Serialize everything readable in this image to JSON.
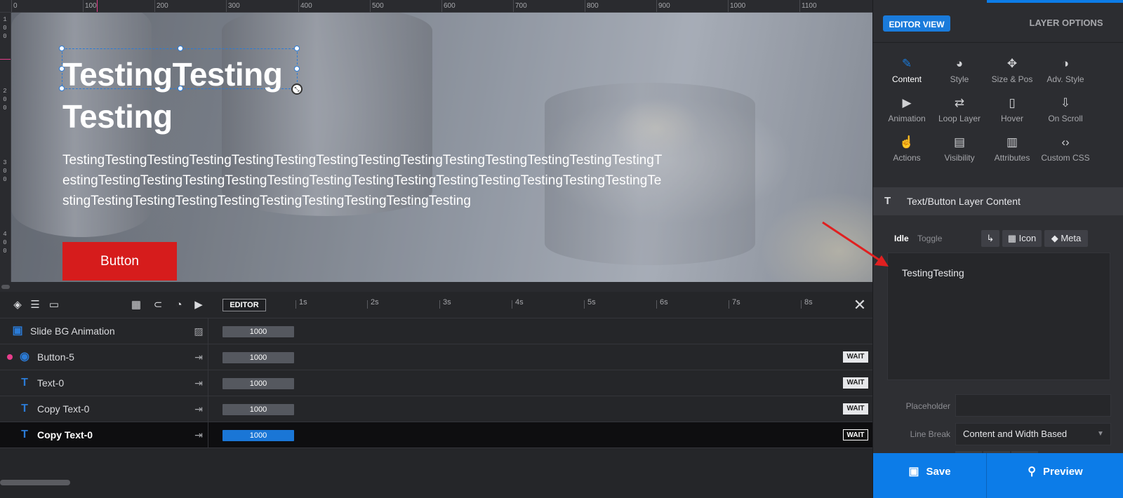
{
  "ruler": {
    "top_labels": [
      "0",
      "100",
      "200",
      "300",
      "400",
      "500",
      "600",
      "700",
      "800",
      "900",
      "1000",
      "1100"
    ],
    "left_labels": [
      "1\n0\n0",
      "2\n0\n0",
      "3\n0\n0",
      "4\n0\n0"
    ]
  },
  "stage": {
    "heading": "TestingTesting Testing",
    "paragraph": "TestingTestingTestingTestingTestingTestingTestingTestingTestingTestingTestingTestingTestingTestingTestingTestingTestingTestingTestingTestingTestingTestingTestingTestingTestingTestingTestingTestingTestingTestingTestingTestingTestingTestingTestingTestingTestingTesting",
    "button_label": "Button"
  },
  "timeline": {
    "editor_label": "EDITOR",
    "seconds": [
      "1s",
      "2s",
      "3s",
      "4s",
      "5s",
      "6s",
      "7s",
      "8s"
    ],
    "rows": [
      {
        "label": "Slide BG Animation",
        "duration": "1000",
        "wait": ""
      },
      {
        "label": "Button-5",
        "duration": "1000",
        "wait": "WAIT"
      },
      {
        "label": "Text-0",
        "duration": "1000",
        "wait": "WAIT"
      },
      {
        "label": "Copy Text-0",
        "duration": "1000",
        "wait": "WAIT"
      },
      {
        "label": "Copy Text-0",
        "duration": "1000",
        "wait": "WAIT"
      }
    ]
  },
  "panel": {
    "editor_view": "EDITOR VIEW",
    "layer_options": "LAYER OPTIONS",
    "tools": [
      {
        "label": "Content",
        "icon": "pencil-icon"
      },
      {
        "label": "Style",
        "icon": "palette-icon"
      },
      {
        "label": "Size & Pos",
        "icon": "move-icon"
      },
      {
        "label": "Adv. Style",
        "icon": "contrast-icon"
      },
      {
        "label": "Animation",
        "icon": "play-icon"
      },
      {
        "label": "Loop Layer",
        "icon": "loop-icon"
      },
      {
        "label": "Hover",
        "icon": "mouse-icon"
      },
      {
        "label": "On Scroll",
        "icon": "scroll-icon"
      },
      {
        "label": "Actions",
        "icon": "hand-pointer-icon"
      },
      {
        "label": "Visibility",
        "icon": "visibility-icon"
      },
      {
        "label": "Attributes",
        "icon": "file-icon"
      },
      {
        "label": "Custom CSS",
        "icon": "code-icon"
      }
    ],
    "section_title": "Text/Button Layer Content",
    "tabs": {
      "idle": "Idle",
      "toggle": "Toggle"
    },
    "pills": {
      "icon": "Icon",
      "meta": "Meta"
    },
    "text_value": "TestingTesting",
    "placeholder_label": "Placeholder",
    "placeholder_value": "",
    "linebreak_label": "Line Break",
    "linebreak_value": "Content and Width Based",
    "save_label": "Save",
    "preview_label": "Preview"
  },
  "colors": {
    "accent": "#0c7ce8",
    "button_red": "#d61c1c",
    "arrow_red": "#e02020",
    "dot_pink": "#e83e8c"
  }
}
